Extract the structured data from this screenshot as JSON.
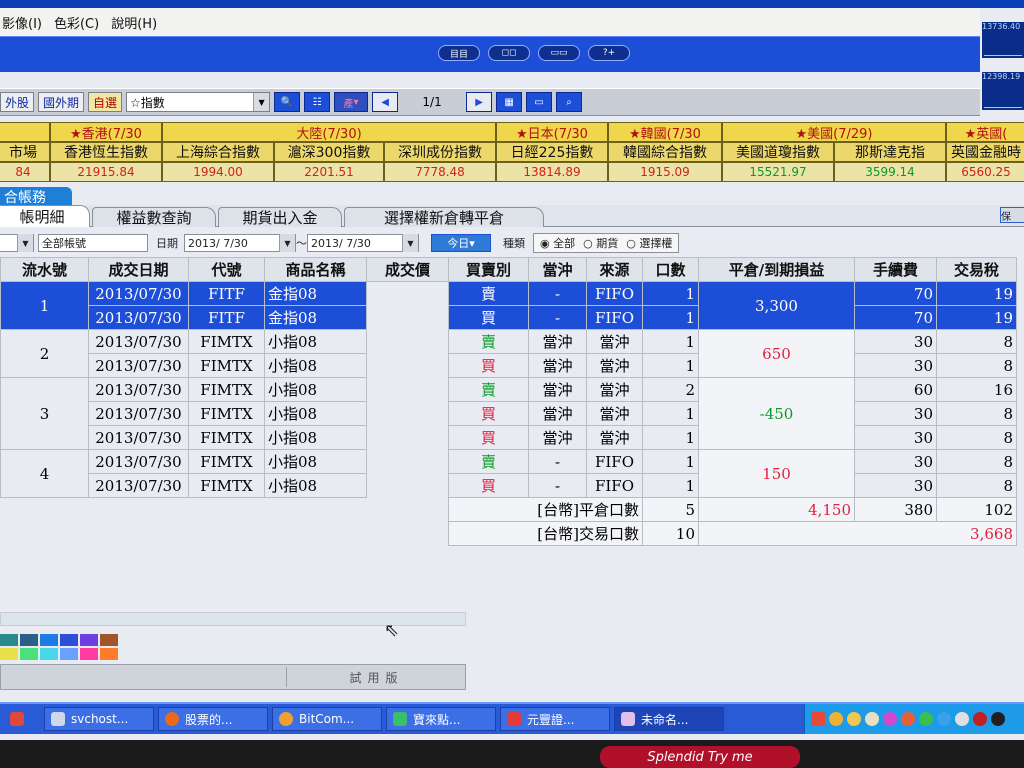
{
  "menu": [
    "影像(I)",
    "色彩(C)",
    "說明(H)"
  ],
  "band_buttons": [
    "目目",
    "◻◻",
    "▭▭",
    "?+"
  ],
  "mini_panels": [
    "13736.40",
    "12398.19"
  ],
  "toolbar": {
    "btn_domestic_stock": "外股",
    "btn_foreign_futures": "國外期",
    "btn_custom": "自選",
    "watch_select": "☆指數",
    "btn_product": "產",
    "page": "1/1"
  },
  "market": {
    "regions": [
      "★香港(7/30",
      "大陸(7/30)",
      "★日本(7/30",
      "★韓國(7/30",
      "★美國(7/29)",
      "★英國("
    ],
    "names": [
      "市場",
      "香港恆生指數",
      "上海綜合指數",
      "滬深300指數",
      "深圳成份指數",
      "日經225指數",
      "韓國綜合指數",
      "美國道瓊指數",
      "那斯達克指",
      "英國金融時"
    ],
    "values": [
      "84",
      "21915.84",
      "1994.00",
      "2201.51",
      "7778.48",
      "13814.89",
      "1915.09",
      "15521.97",
      "3599.14",
      "6560.25"
    ]
  },
  "account_label": "合帳務",
  "tabs": [
    "帳明細",
    "權益數查詢",
    "期貨出入金",
    "選擇權新倉轉平倉"
  ],
  "print_label": "保",
  "filter": {
    "account": "全部帳號",
    "date_label": "日期",
    "date_from": "2013/ 7/30",
    "tilde": "～",
    "date_to": "2013/ 7/30",
    "today": "今日",
    "type_label": "種類",
    "type_all": "全部",
    "type_futures": "期貨",
    "type_options": "選擇權"
  },
  "columns": [
    "流水號",
    "成交日期",
    "代號",
    "商品名稱",
    "成交價",
    "買賣別",
    "當沖",
    "來源",
    "口數",
    "平倉/到期損益",
    "手續費",
    "交易稅"
  ],
  "groups": [
    {
      "no": "1",
      "pl": "3,300",
      "rows": [
        {
          "date": "2013/07/30",
          "code": "FITF",
          "name": "金指08",
          "side": "賣",
          "dt": "-",
          "src": "FIFO",
          "qty": "1",
          "fee": "70",
          "tax": "19"
        },
        {
          "date": "2013/07/30",
          "code": "FITF",
          "name": "金指08",
          "side": "買",
          "dt": "-",
          "src": "FIFO",
          "qty": "1",
          "fee": "70",
          "tax": "19"
        }
      ]
    },
    {
      "no": "2",
      "pl": "650",
      "rows": [
        {
          "date": "2013/07/30",
          "code": "FIMTX",
          "name": "小指08",
          "side": "賣",
          "dt": "當沖",
          "src": "當沖",
          "qty": "1",
          "fee": "30",
          "tax": "8"
        },
        {
          "date": "2013/07/30",
          "code": "FIMTX",
          "name": "小指08",
          "side": "買",
          "dt": "當沖",
          "src": "當沖",
          "qty": "1",
          "fee": "30",
          "tax": "8"
        }
      ]
    },
    {
      "no": "3",
      "pl": "-450",
      "rows": [
        {
          "date": "2013/07/30",
          "code": "FIMTX",
          "name": "小指08",
          "side": "賣",
          "dt": "當沖",
          "src": "當沖",
          "qty": "2",
          "fee": "60",
          "tax": "16"
        },
        {
          "date": "2013/07/30",
          "code": "FIMTX",
          "name": "小指08",
          "side": "買",
          "dt": "當沖",
          "src": "當沖",
          "qty": "1",
          "fee": "30",
          "tax": "8"
        },
        {
          "date": "2013/07/30",
          "code": "FIMTX",
          "name": "小指08",
          "side": "買",
          "dt": "當沖",
          "src": "當沖",
          "qty": "1",
          "fee": "30",
          "tax": "8"
        }
      ]
    },
    {
      "no": "4",
      "pl": "150",
      "rows": [
        {
          "date": "2013/07/30",
          "code": "FIMTX",
          "name": "小指08",
          "side": "賣",
          "dt": "-",
          "src": "FIFO",
          "qty": "1",
          "fee": "30",
          "tax": "8"
        },
        {
          "date": "2013/07/30",
          "code": "FIMTX",
          "name": "小指08",
          "side": "買",
          "dt": "-",
          "src": "FIFO",
          "qty": "1",
          "fee": "30",
          "tax": "8"
        }
      ]
    }
  ],
  "summary": {
    "close_label": "[台幣]平倉口數",
    "close_qty": "5",
    "close_pl": "4,150",
    "close_fee": "380",
    "close_tax": "102",
    "trade_label": "[台幣]交易口數",
    "trade_qty": "10",
    "trade_total": "3,668"
  },
  "trial_label": "試用版",
  "taskbar": [
    {
      "label": "svchost...",
      "icon": "window-icon"
    },
    {
      "label": "股票的...",
      "icon": "firefox-icon"
    },
    {
      "label": "BitCom...",
      "icon": "bitcomet-icon"
    },
    {
      "label": "寶來點...",
      "icon": "chart-icon"
    },
    {
      "label": "元豐證...",
      "icon": "app-icon"
    },
    {
      "label": "未命名...",
      "icon": "paint-icon"
    }
  ],
  "brand": "Splendid Try me",
  "colors": {
    "accent": "#1d4ed8",
    "sell": "#0a9a2a",
    "buy": "#e02040"
  }
}
